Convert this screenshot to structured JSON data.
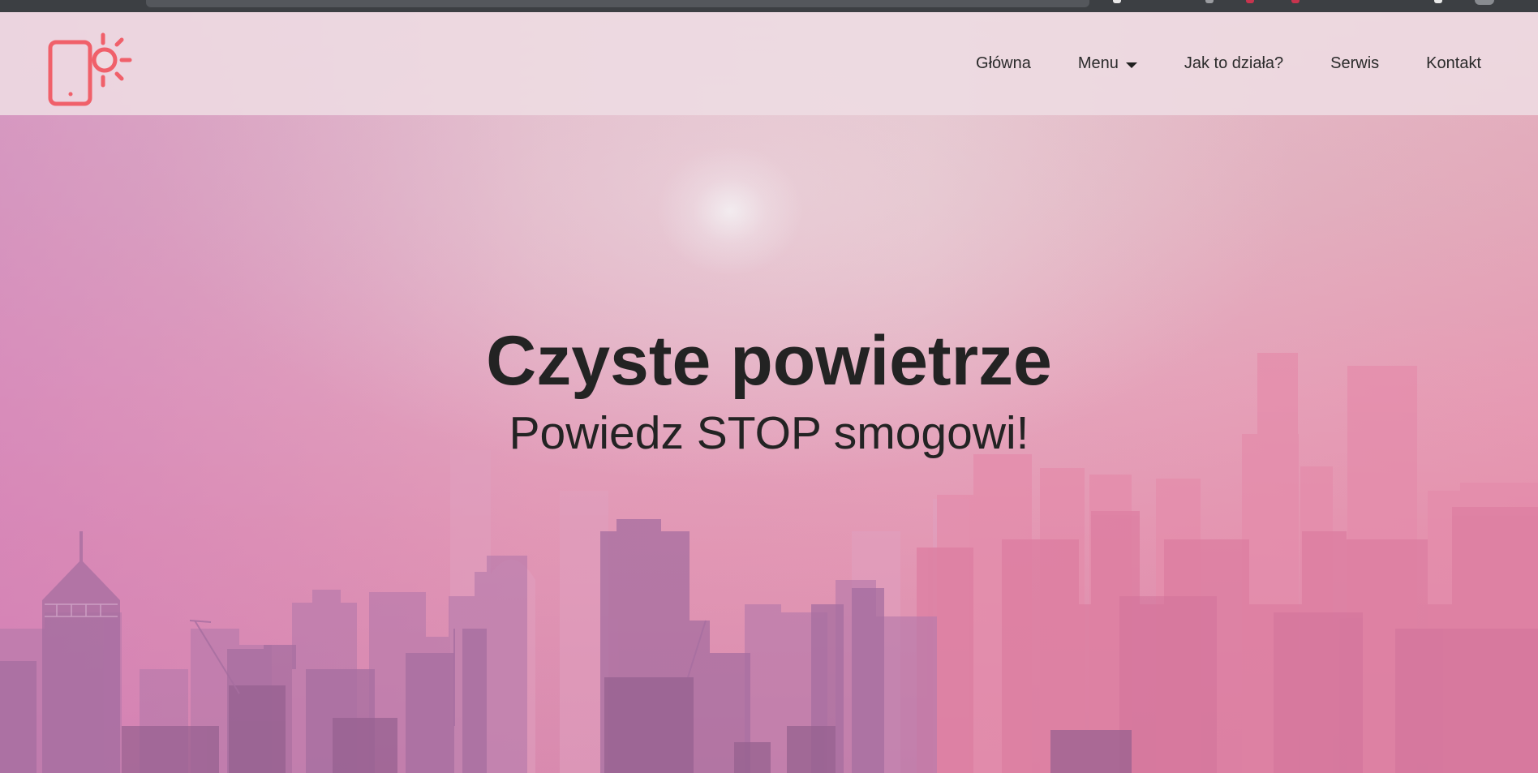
{
  "header": {
    "logo_icon": "phone-sun-icon",
    "accent_color": "#f0606a"
  },
  "nav": {
    "items": [
      {
        "label": "Główna"
      },
      {
        "label": "Menu",
        "has_dropdown": true
      },
      {
        "label": "Jak to działa?"
      },
      {
        "label": "Serwis"
      },
      {
        "label": "Kontakt"
      }
    ]
  },
  "hero": {
    "title": "Czyste powietrze",
    "subtitle": "Powiedz STOP smogowi!",
    "background": "pink-hazy-city-skyline"
  }
}
